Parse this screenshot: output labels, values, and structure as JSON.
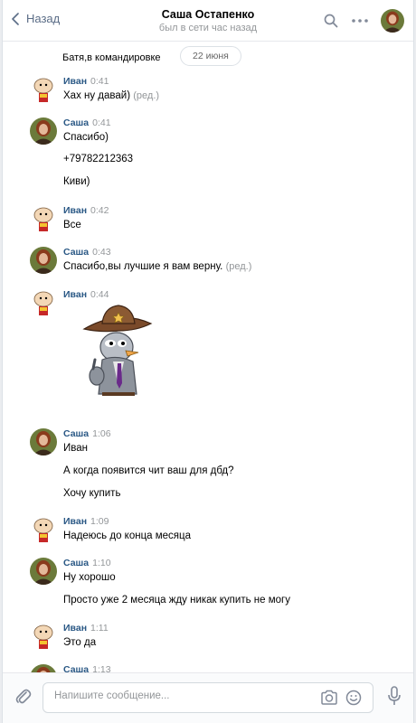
{
  "header": {
    "back_label": "Назад",
    "title": "Саша Остапенко",
    "status": "был в сети час назад"
  },
  "chat": {
    "first_line": "Батя,в командировке",
    "date_pill": "22 июня",
    "messages": [
      {
        "author": "Иван",
        "time": "0:41",
        "lines": [
          "Хах ну давай)"
        ],
        "edited": "(ред.)",
        "avatar": "stewie-icon"
      },
      {
        "author": "Саша",
        "time": "0:41",
        "lines": [
          "Спасибо)",
          "+79782212363",
          "Киви)"
        ],
        "avatar": "portrait-icon"
      },
      {
        "author": "Иван",
        "time": "0:42",
        "lines": [
          "Все"
        ],
        "avatar": "stewie-icon"
      },
      {
        "author": "Саша",
        "time": "0:43",
        "lines": [
          "Спасибо,вы лучшие я вам верну."
        ],
        "edited": "(ред.)",
        "avatar": "portrait-icon"
      },
      {
        "author": "Иван",
        "time": "0:44",
        "sticker": "cowboy-pigeon-sticker",
        "avatar": "stewie-icon"
      },
      {
        "author": "Саша",
        "time": "1:06",
        "lines": [
          "Иван",
          "А когда появится чит ваш для дбд?",
          "Хочу купить"
        ],
        "avatar": "portrait-icon"
      },
      {
        "author": "Иван",
        "time": "1:09",
        "lines": [
          "Надеюсь до конца месяца"
        ],
        "avatar": "stewie-icon"
      },
      {
        "author": "Саша",
        "time": "1:10",
        "lines": [
          "Ну хорошо",
          "Просто уже 2 месяца жду никак купить не могу"
        ],
        "avatar": "portrait-icon"
      },
      {
        "author": "Иван",
        "time": "1:11",
        "lines": [
          "Это да"
        ],
        "avatar": "stewie-icon"
      },
      {
        "author": "Саша",
        "time": "1:13",
        "lines": [],
        "avatar": "portrait-icon"
      }
    ]
  },
  "composer": {
    "placeholder": "Напишите сообщение...",
    "value": ""
  },
  "colors": {
    "accent": "#2a5885",
    "muted": "#939699",
    "nav": "#5b6d87"
  }
}
